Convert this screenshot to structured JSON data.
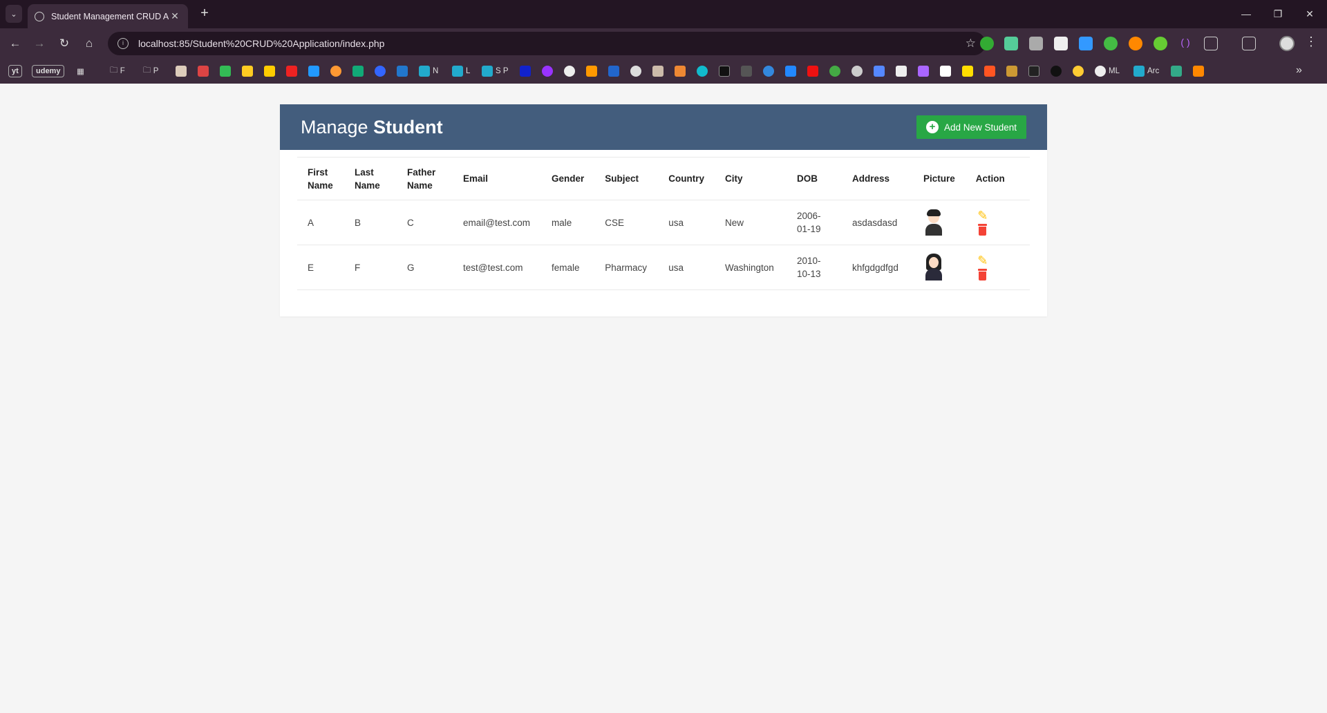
{
  "browser": {
    "tab_title": "Student Management CRUD Ap",
    "url": "localhost:85/Student%20CRUD%20Application/index.php",
    "bookmarks": [
      "yt",
      "udemy",
      "F",
      "P",
      "N",
      "L",
      "S P",
      "ML",
      "Arc"
    ]
  },
  "page": {
    "title_light": "Manage",
    "title_bold": "Student",
    "add_button": "Add New Student",
    "columns": [
      "First Name",
      "Last Name",
      "Father Name",
      "Email",
      "Gender",
      "Subject",
      "Country",
      "City",
      "DOB",
      "Address",
      "Picture",
      "Action"
    ],
    "rows": [
      {
        "first": "A",
        "last": "B",
        "father": "C",
        "email": "email@test.com",
        "gender": "male",
        "subject": "CSE",
        "country": "usa",
        "city": "New",
        "dob": "2006-01-19",
        "address": "asdasdasd",
        "picture": "male-avatar"
      },
      {
        "first": "E",
        "last": "F",
        "father": "G",
        "email": "test@test.com",
        "gender": "female",
        "subject": "Pharmacy",
        "country": "usa",
        "city": "Washington",
        "dob": "2010-10-13",
        "address": "khfgdgdfgd",
        "picture": "female-avatar"
      }
    ]
  },
  "colors": {
    "header_bg": "#435d7d",
    "add_button": "#28a745",
    "edit_icon": "#ffc107",
    "delete_icon": "#f44336"
  }
}
